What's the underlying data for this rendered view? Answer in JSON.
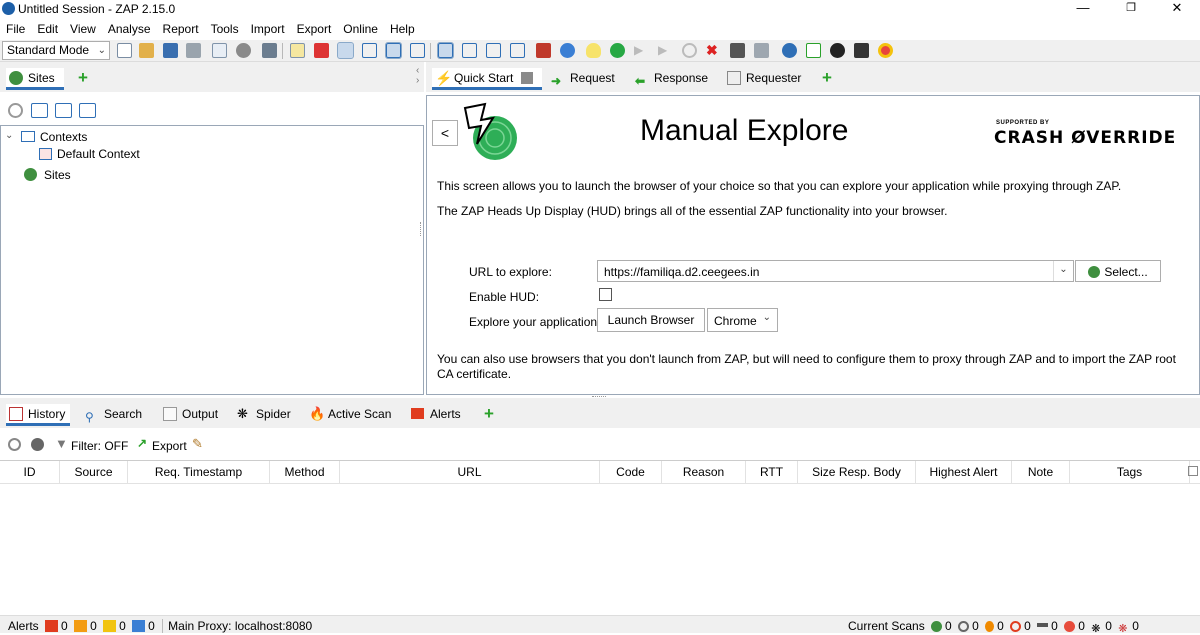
{
  "window": {
    "title": "Untitled Session - ZAP 2.15.0"
  },
  "menu": [
    "File",
    "Edit",
    "View",
    "Analyse",
    "Report",
    "Tools",
    "Import",
    "Export",
    "Online",
    "Help"
  ],
  "toolbar": {
    "mode": "Standard Mode"
  },
  "left_tabs": {
    "sites_label": "Sites"
  },
  "tree": {
    "contexts": "Contexts",
    "default_context": "Default Context",
    "sites": "Sites"
  },
  "main_tabs": {
    "quick_start": "Quick Start",
    "request": "Request",
    "response": "Response",
    "requester": "Requester"
  },
  "manual_explore": {
    "back": "<",
    "title": "Manual Explore",
    "supported_by": "SUPPORTED BY",
    "sponsor": "CRASH ØVERRIDE",
    "desc1": "This screen allows you to launch the browser of your choice so that you can explore your application while proxying through ZAP.",
    "desc2": "The ZAP Heads Up Display (HUD) brings all of the essential ZAP functionality into your browser.",
    "url_label": "URL to explore:",
    "url_value": "https://familiqa.d2.ceegees.in",
    "select_btn": "Select...",
    "hud_label": "Enable HUD:",
    "hud_checked": false,
    "explore_label": "Explore your application:",
    "launch_btn": "Launch Browser",
    "browser": "Chrome",
    "footer": "You can also use browsers that you don't launch from ZAP, but will need to configure them to proxy through ZAP and to import the ZAP root CA certificate."
  },
  "bottom_tabs": {
    "history": "History",
    "search": "Search",
    "output": "Output",
    "spider": "Spider",
    "active_scan": "Active Scan",
    "alerts": "Alerts"
  },
  "history_toolbar": {
    "filter": "Filter: OFF",
    "export": "Export"
  },
  "history_columns": [
    "ID",
    "Source",
    "Req. Timestamp",
    "Method",
    "URL",
    "Code",
    "Reason",
    "RTT",
    "Size Resp. Body",
    "Highest Alert",
    "Note",
    "Tags"
  ],
  "status": {
    "alerts_label": "Alerts",
    "alert_counts": [
      "0",
      "0",
      "0",
      "0"
    ],
    "proxy": "Main Proxy: localhost:8080",
    "current_scans": "Current Scans",
    "scan_counts": [
      "0",
      "0",
      "0",
      "0",
      "0",
      "0",
      "0",
      "0"
    ]
  },
  "colors": {
    "tab_accent": "#2f6fb6",
    "add_green": "#2aa12a",
    "flag_red": "#e03c1f",
    "flag_orange": "#f39c12",
    "flag_yellow": "#f1c40f",
    "flag_blue": "#3b7fd4"
  }
}
